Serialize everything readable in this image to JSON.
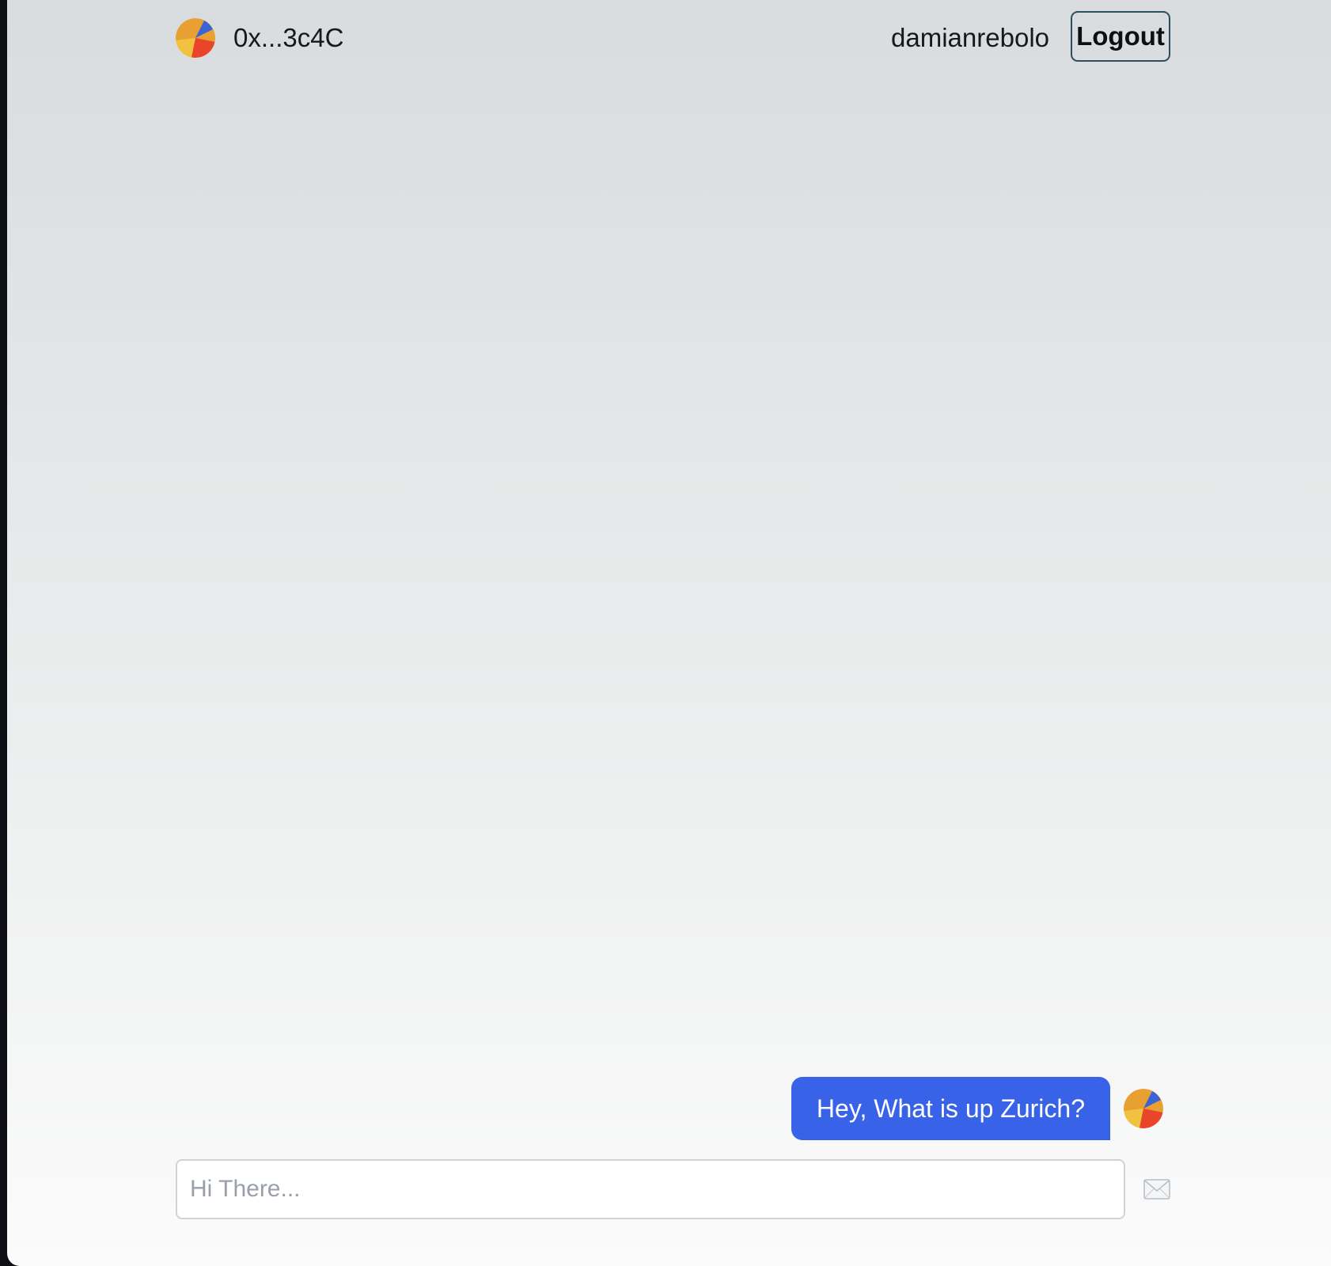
{
  "header": {
    "wallet_address": "0x...3c4C",
    "username": "damianrebolo",
    "logout_label": "Logout"
  },
  "messages": [
    {
      "text": "Hey, What is up Zurich?",
      "sender": "self"
    }
  ],
  "composer": {
    "placeholder": "Hi There...",
    "value": "",
    "send_icon": "envelope-icon"
  },
  "colors": {
    "bubble": "#3862e8",
    "avatar_orange": "#e8a033",
    "avatar_red": "#e8452b",
    "avatar_blue": "#3a63d6",
    "avatar_yellow": "#f0c240",
    "logout_border": "#2d4d62"
  }
}
